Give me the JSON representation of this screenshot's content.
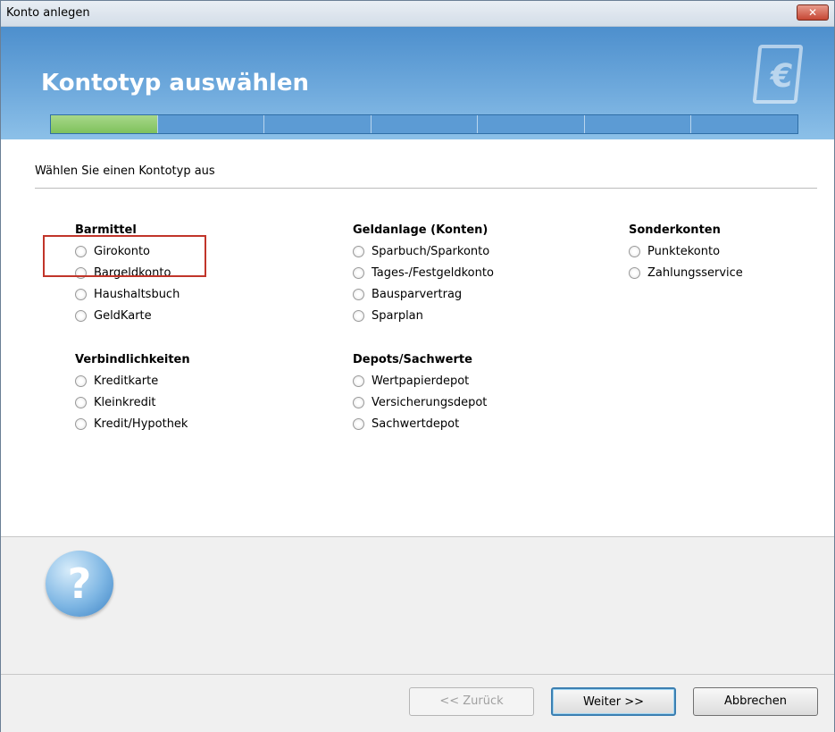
{
  "window": {
    "title": "Konto anlegen",
    "close_glyph": "✕"
  },
  "banner": {
    "heading": "Kontotyp auswählen",
    "euro_glyph": "€",
    "progress_steps_total": 7,
    "progress_steps_done": 1
  },
  "content": {
    "instruction": "Wählen Sie einen Kontotyp aus"
  },
  "groups": {
    "barmittel": {
      "title": "Barmittel",
      "items": [
        "Girokonto",
        "Bargeldkonto",
        "Haushaltsbuch",
        "GeldKarte"
      ]
    },
    "verbindlichkeiten": {
      "title": "Verbindlichkeiten",
      "items": [
        "Kreditkarte",
        "Kleinkredit",
        "Kredit/Hypothek"
      ]
    },
    "geldanlage": {
      "title": "Geldanlage (Konten)",
      "items": [
        "Sparbuch/Sparkonto",
        "Tages-/Festgeldkonto",
        "Bausparvertrag",
        "Sparplan"
      ]
    },
    "depots": {
      "title": "Depots/Sachwerte",
      "items": [
        "Wertpapierdepot",
        "Versicherungsdepot",
        "Sachwertdepot"
      ]
    },
    "sonderkonten": {
      "title": "Sonderkonten",
      "items": [
        "Punktekonto",
        "Zahlungsservice"
      ]
    }
  },
  "help": {
    "icon_glyph": "?"
  },
  "footer": {
    "back_label": "<< Zurück",
    "next_label": "Weiter >>",
    "cancel_label": "Abbrechen"
  },
  "colors": {
    "banner_blue": "#5c9bd4",
    "progress_done": "#8cc96a",
    "highlight_red": "#c1352a"
  }
}
